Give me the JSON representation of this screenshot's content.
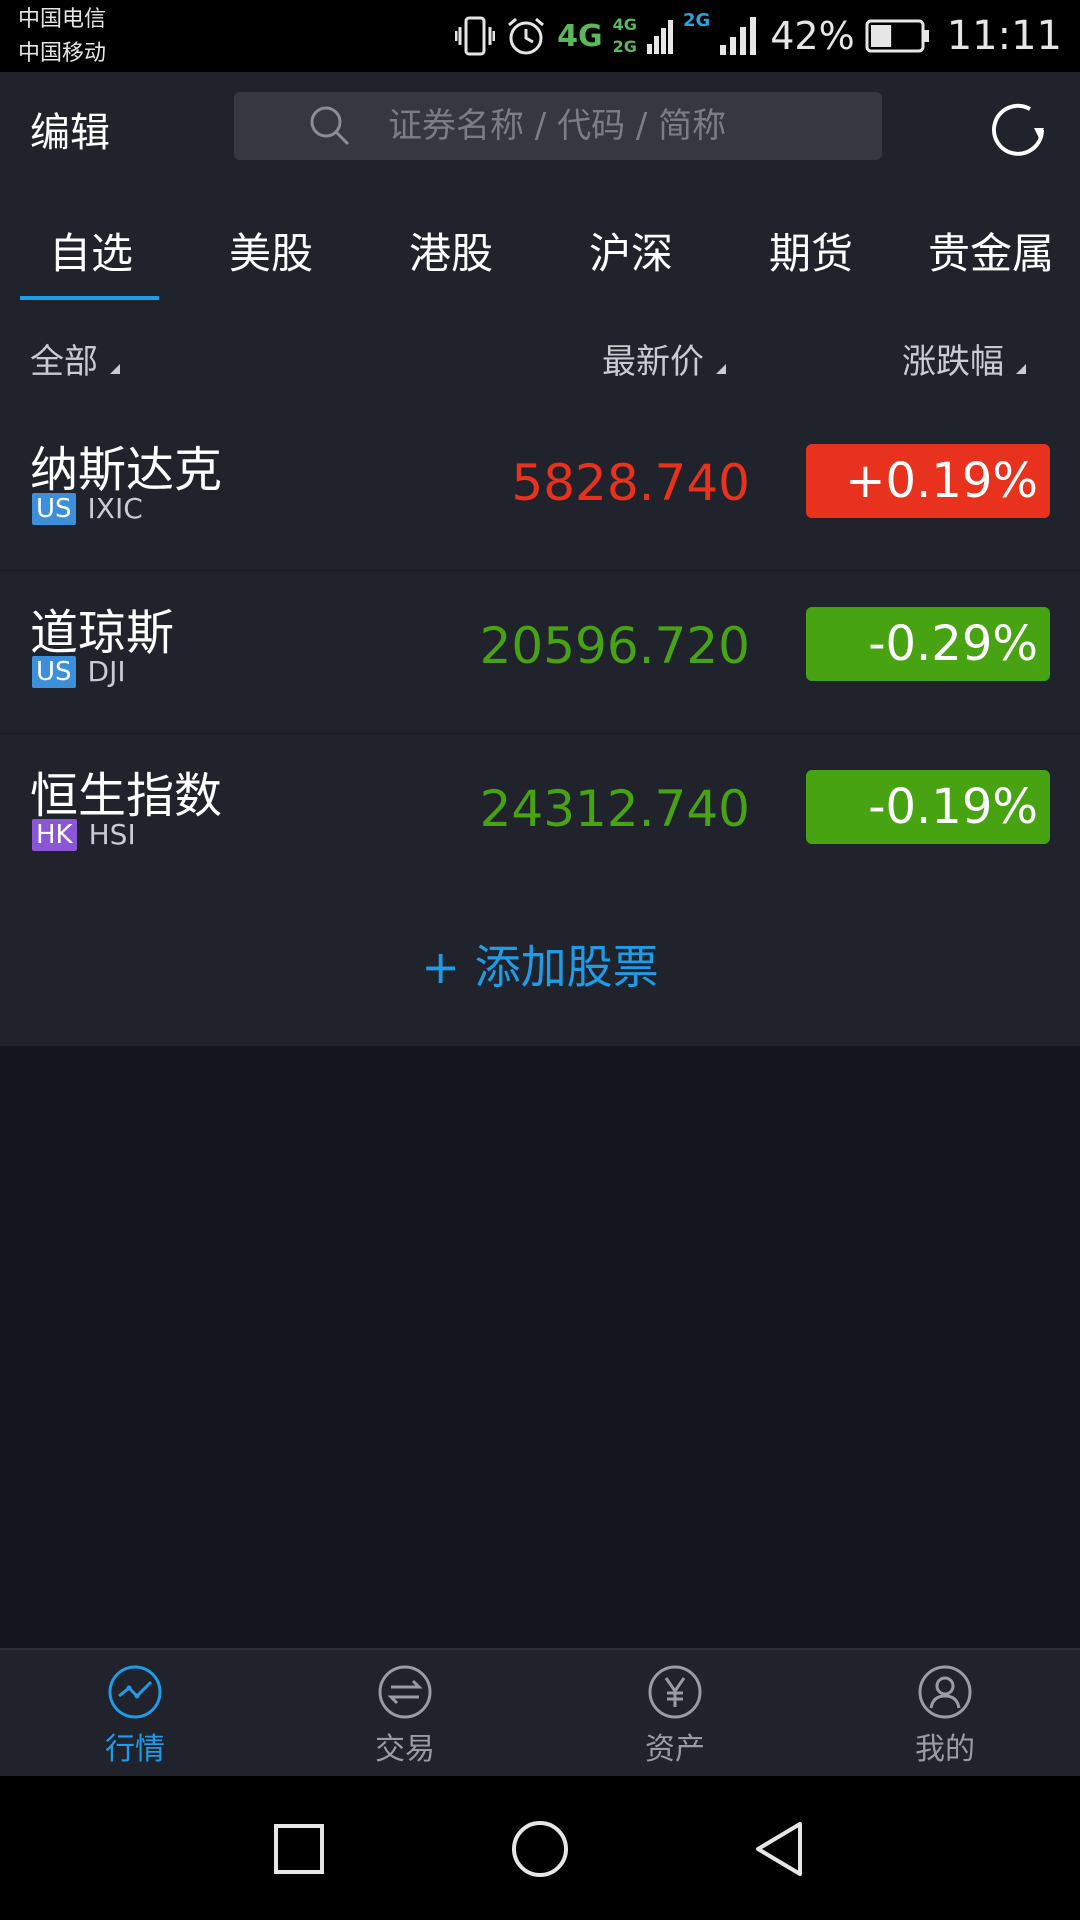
{
  "status_bar": {
    "carrier_1": "中国电信",
    "carrier_2": "中国移动",
    "network_primary": "4G",
    "network_secondary_top": "4G",
    "network_secondary_bottom": "2G",
    "network_tertiary": "2G",
    "battery_percent": "42%",
    "battery_level": 0.42,
    "time": "11:11",
    "icons": [
      "vibrate-icon",
      "alarm-icon",
      "signal-icon",
      "battery-icon"
    ]
  },
  "header": {
    "edit_label": "编辑",
    "search_placeholder": "证券名称 / 代码 / 简称",
    "icons": [
      "search-icon",
      "refresh-icon"
    ]
  },
  "tabs": [
    {
      "label": "自选",
      "active": true
    },
    {
      "label": "美股",
      "active": false
    },
    {
      "label": "港股",
      "active": false
    },
    {
      "label": "沪深",
      "active": false
    },
    {
      "label": "期货",
      "active": false
    },
    {
      "label": "贵金属",
      "active": false
    }
  ],
  "columns": {
    "all": "全部",
    "latest_price": "最新价",
    "change_pct": "涨跌幅"
  },
  "stocks": [
    {
      "name": "纳斯达克",
      "market": "US",
      "code": "IXIC",
      "price": "5828.740",
      "change": "+0.19%",
      "direction": "up"
    },
    {
      "name": "道琼斯",
      "market": "US",
      "code": "DJI",
      "price": "20596.720",
      "change": "-0.29%",
      "direction": "down"
    },
    {
      "name": "恒生指数",
      "market": "HK",
      "code": "HSI",
      "price": "24312.740",
      "change": "-0.19%",
      "direction": "down"
    }
  ],
  "add_stock_label": "+ 添加股票",
  "bottom_nav": [
    {
      "label": "行情",
      "icon": "market-chart-icon",
      "active": true
    },
    {
      "label": "交易",
      "icon": "trade-exchange-icon",
      "active": false
    },
    {
      "label": "资产",
      "icon": "assets-yen-icon",
      "active": false
    },
    {
      "label": "我的",
      "icon": "profile-icon",
      "active": false
    }
  ],
  "colors": {
    "accent": "#1e9ce8",
    "up": "#e8321e",
    "down": "#48a312",
    "badge_us": "#3d8fd9",
    "badge_hk": "#8a56d6"
  }
}
